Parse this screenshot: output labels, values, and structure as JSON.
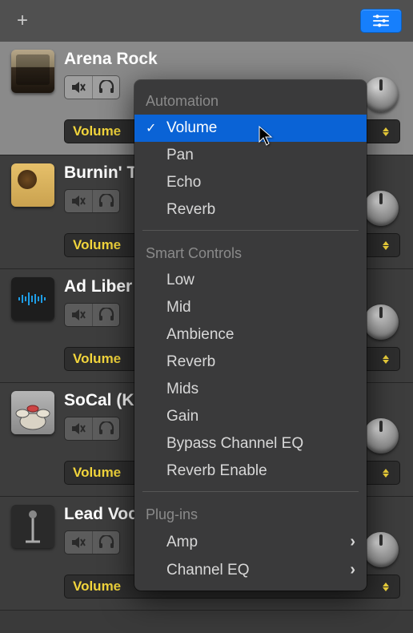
{
  "tracks": [
    {
      "name": "Arena Rock",
      "param": "Volume",
      "iconClass": "ico-amp",
      "selected": true
    },
    {
      "name": "Burnin' T",
      "param": "Volume",
      "iconClass": "ico-tweed",
      "selected": false
    },
    {
      "name": "Ad Liber",
      "param": "Volume",
      "iconClass": "ico-wave",
      "selected": false
    },
    {
      "name": "SoCal (K",
      "param": "Volume",
      "iconClass": "ico-drums",
      "selected": false
    },
    {
      "name": "Lead Voc",
      "param": "Volume",
      "iconClass": "ico-mic",
      "selected": false
    }
  ],
  "menu": {
    "sections": [
      {
        "title": "Automation",
        "items": [
          {
            "label": "Volume",
            "checked": true,
            "submenu": false
          },
          {
            "label": "Pan",
            "checked": false,
            "submenu": false
          },
          {
            "label": "Echo",
            "checked": false,
            "submenu": false
          },
          {
            "label": "Reverb",
            "checked": false,
            "submenu": false
          }
        ]
      },
      {
        "title": "Smart Controls",
        "items": [
          {
            "label": "Low",
            "checked": false,
            "submenu": false
          },
          {
            "label": "Mid",
            "checked": false,
            "submenu": false
          },
          {
            "label": "Ambience",
            "checked": false,
            "submenu": false
          },
          {
            "label": "Reverb",
            "checked": false,
            "submenu": false
          },
          {
            "label": "Mids",
            "checked": false,
            "submenu": false
          },
          {
            "label": "Gain",
            "checked": false,
            "submenu": false
          },
          {
            "label": "Bypass Channel EQ",
            "checked": false,
            "submenu": false
          },
          {
            "label": "Reverb Enable",
            "checked": false,
            "submenu": false
          }
        ]
      },
      {
        "title": "Plug-ins",
        "items": [
          {
            "label": "Amp",
            "checked": false,
            "submenu": true
          },
          {
            "label": "Channel EQ",
            "checked": false,
            "submenu": true
          }
        ]
      }
    ]
  }
}
